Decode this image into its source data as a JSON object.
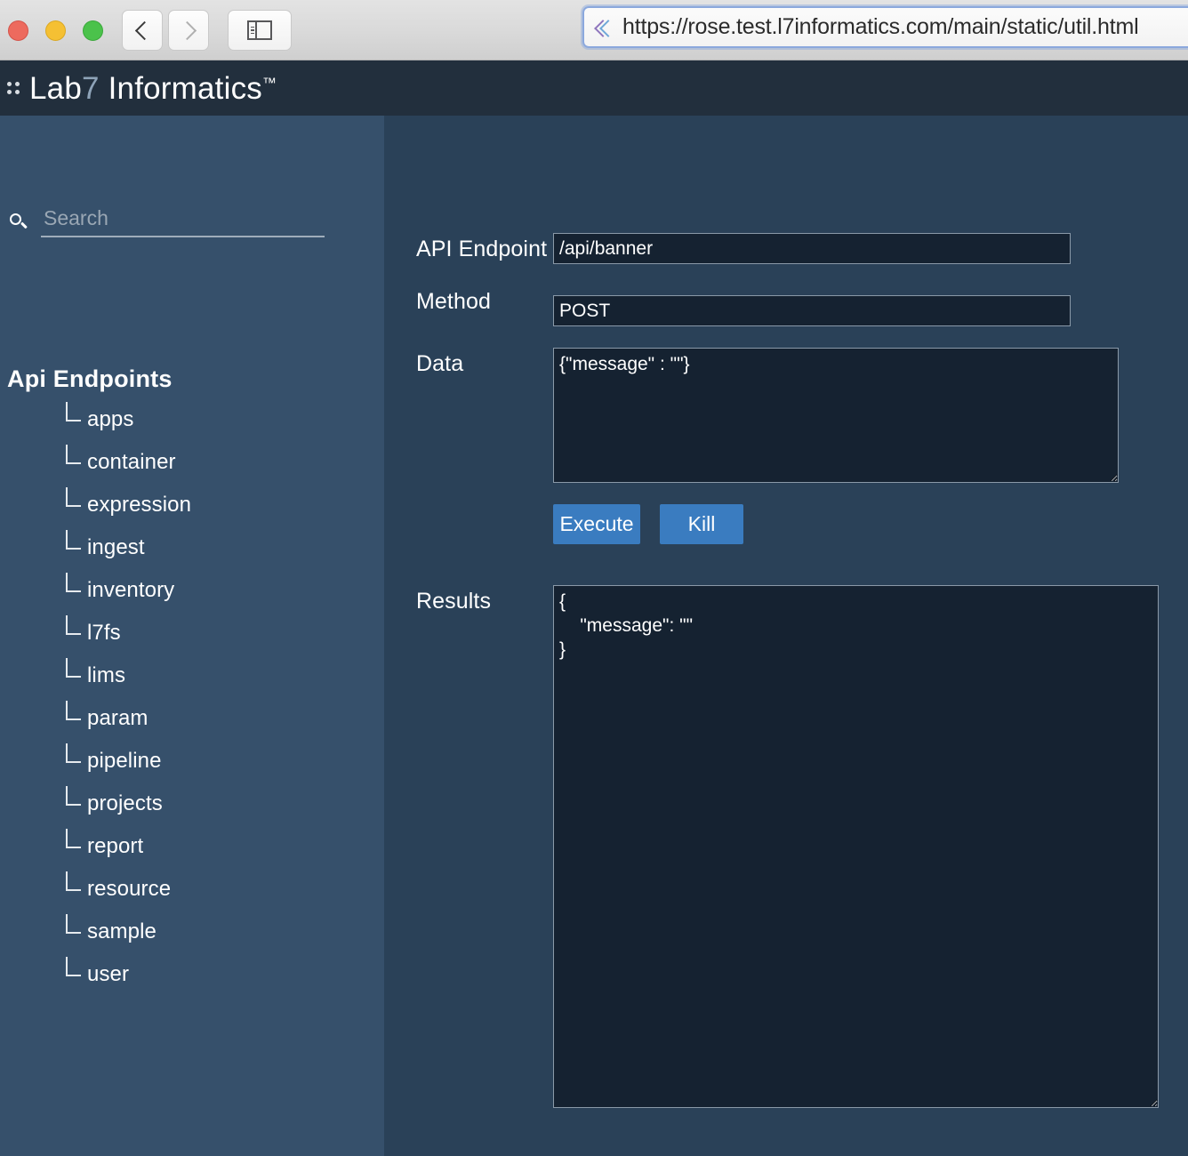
{
  "browser": {
    "url": "https://rose.test.l7informatics.com/main/static/util.html",
    "back_label": "Back",
    "forward_label": "Forward",
    "sidebar_toggle_label": "Show Sidebar"
  },
  "app": {
    "brand_prefix": "Lab",
    "brand_seven": "7",
    "brand_suffix": "Informatics",
    "brand_tm": "™",
    "header_bg": "#222f3d",
    "sidebar_bg": "#36506b",
    "main_bg": "#2a4158",
    "accent": "#3a7cc0",
    "field_bg": "#152231"
  },
  "sidebar": {
    "search": {
      "value": "",
      "placeholder": "Search"
    },
    "tree_title": "Api Endpoints",
    "items": [
      {
        "label": "apps"
      },
      {
        "label": "container"
      },
      {
        "label": "expression"
      },
      {
        "label": "ingest"
      },
      {
        "label": "inventory"
      },
      {
        "label": "l7fs"
      },
      {
        "label": "lims"
      },
      {
        "label": "param"
      },
      {
        "label": "pipeline"
      },
      {
        "label": "projects"
      },
      {
        "label": "report"
      },
      {
        "label": "resource"
      },
      {
        "label": "sample"
      },
      {
        "label": "user"
      }
    ]
  },
  "form": {
    "endpoint_label": "API Endpoint",
    "endpoint_value": "/api/banner",
    "method_label": "Method",
    "method_value": "POST",
    "data_label": "Data",
    "data_value": "{\"message\" : \"\"}",
    "execute_label": "Execute",
    "kill_label": "Kill",
    "results_label": "Results",
    "results_value": "{\n    \"message\": \"\"\n}"
  }
}
